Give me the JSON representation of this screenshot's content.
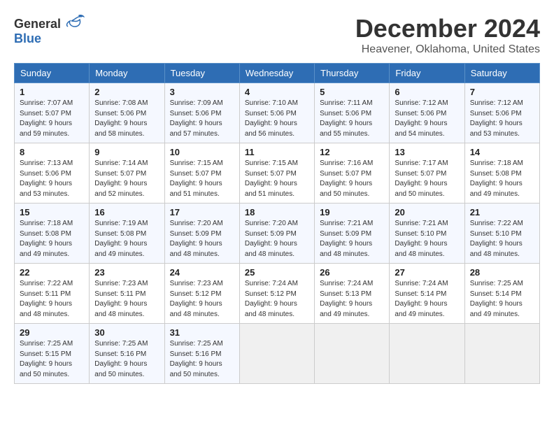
{
  "header": {
    "logo_general": "General",
    "logo_blue": "Blue",
    "month": "December 2024",
    "location": "Heavener, Oklahoma, United States"
  },
  "days_of_week": [
    "Sunday",
    "Monday",
    "Tuesday",
    "Wednesday",
    "Thursday",
    "Friday",
    "Saturday"
  ],
  "weeks": [
    [
      {
        "day": "1",
        "sunrise": "Sunrise: 7:07 AM",
        "sunset": "Sunset: 5:07 PM",
        "daylight": "Daylight: 9 hours and 59 minutes."
      },
      {
        "day": "2",
        "sunrise": "Sunrise: 7:08 AM",
        "sunset": "Sunset: 5:06 PM",
        "daylight": "Daylight: 9 hours and 58 minutes."
      },
      {
        "day": "3",
        "sunrise": "Sunrise: 7:09 AM",
        "sunset": "Sunset: 5:06 PM",
        "daylight": "Daylight: 9 hours and 57 minutes."
      },
      {
        "day": "4",
        "sunrise": "Sunrise: 7:10 AM",
        "sunset": "Sunset: 5:06 PM",
        "daylight": "Daylight: 9 hours and 56 minutes."
      },
      {
        "day": "5",
        "sunrise": "Sunrise: 7:11 AM",
        "sunset": "Sunset: 5:06 PM",
        "daylight": "Daylight: 9 hours and 55 minutes."
      },
      {
        "day": "6",
        "sunrise": "Sunrise: 7:12 AM",
        "sunset": "Sunset: 5:06 PM",
        "daylight": "Daylight: 9 hours and 54 minutes."
      },
      {
        "day": "7",
        "sunrise": "Sunrise: 7:12 AM",
        "sunset": "Sunset: 5:06 PM",
        "daylight": "Daylight: 9 hours and 53 minutes."
      }
    ],
    [
      {
        "day": "8",
        "sunrise": "Sunrise: 7:13 AM",
        "sunset": "Sunset: 5:06 PM",
        "daylight": "Daylight: 9 hours and 53 minutes."
      },
      {
        "day": "9",
        "sunrise": "Sunrise: 7:14 AM",
        "sunset": "Sunset: 5:07 PM",
        "daylight": "Daylight: 9 hours and 52 minutes."
      },
      {
        "day": "10",
        "sunrise": "Sunrise: 7:15 AM",
        "sunset": "Sunset: 5:07 PM",
        "daylight": "Daylight: 9 hours and 51 minutes."
      },
      {
        "day": "11",
        "sunrise": "Sunrise: 7:15 AM",
        "sunset": "Sunset: 5:07 PM",
        "daylight": "Daylight: 9 hours and 51 minutes."
      },
      {
        "day": "12",
        "sunrise": "Sunrise: 7:16 AM",
        "sunset": "Sunset: 5:07 PM",
        "daylight": "Daylight: 9 hours and 50 minutes."
      },
      {
        "day": "13",
        "sunrise": "Sunrise: 7:17 AM",
        "sunset": "Sunset: 5:07 PM",
        "daylight": "Daylight: 9 hours and 50 minutes."
      },
      {
        "day": "14",
        "sunrise": "Sunrise: 7:18 AM",
        "sunset": "Sunset: 5:08 PM",
        "daylight": "Daylight: 9 hours and 49 minutes."
      }
    ],
    [
      {
        "day": "15",
        "sunrise": "Sunrise: 7:18 AM",
        "sunset": "Sunset: 5:08 PM",
        "daylight": "Daylight: 9 hours and 49 minutes."
      },
      {
        "day": "16",
        "sunrise": "Sunrise: 7:19 AM",
        "sunset": "Sunset: 5:08 PM",
        "daylight": "Daylight: 9 hours and 49 minutes."
      },
      {
        "day": "17",
        "sunrise": "Sunrise: 7:20 AM",
        "sunset": "Sunset: 5:09 PM",
        "daylight": "Daylight: 9 hours and 48 minutes."
      },
      {
        "day": "18",
        "sunrise": "Sunrise: 7:20 AM",
        "sunset": "Sunset: 5:09 PM",
        "daylight": "Daylight: 9 hours and 48 minutes."
      },
      {
        "day": "19",
        "sunrise": "Sunrise: 7:21 AM",
        "sunset": "Sunset: 5:09 PM",
        "daylight": "Daylight: 9 hours and 48 minutes."
      },
      {
        "day": "20",
        "sunrise": "Sunrise: 7:21 AM",
        "sunset": "Sunset: 5:10 PM",
        "daylight": "Daylight: 9 hours and 48 minutes."
      },
      {
        "day": "21",
        "sunrise": "Sunrise: 7:22 AM",
        "sunset": "Sunset: 5:10 PM",
        "daylight": "Daylight: 9 hours and 48 minutes."
      }
    ],
    [
      {
        "day": "22",
        "sunrise": "Sunrise: 7:22 AM",
        "sunset": "Sunset: 5:11 PM",
        "daylight": "Daylight: 9 hours and 48 minutes."
      },
      {
        "day": "23",
        "sunrise": "Sunrise: 7:23 AM",
        "sunset": "Sunset: 5:11 PM",
        "daylight": "Daylight: 9 hours and 48 minutes."
      },
      {
        "day": "24",
        "sunrise": "Sunrise: 7:23 AM",
        "sunset": "Sunset: 5:12 PM",
        "daylight": "Daylight: 9 hours and 48 minutes."
      },
      {
        "day": "25",
        "sunrise": "Sunrise: 7:24 AM",
        "sunset": "Sunset: 5:12 PM",
        "daylight": "Daylight: 9 hours and 48 minutes."
      },
      {
        "day": "26",
        "sunrise": "Sunrise: 7:24 AM",
        "sunset": "Sunset: 5:13 PM",
        "daylight": "Daylight: 9 hours and 49 minutes."
      },
      {
        "day": "27",
        "sunrise": "Sunrise: 7:24 AM",
        "sunset": "Sunset: 5:14 PM",
        "daylight": "Daylight: 9 hours and 49 minutes."
      },
      {
        "day": "28",
        "sunrise": "Sunrise: 7:25 AM",
        "sunset": "Sunset: 5:14 PM",
        "daylight": "Daylight: 9 hours and 49 minutes."
      }
    ],
    [
      {
        "day": "29",
        "sunrise": "Sunrise: 7:25 AM",
        "sunset": "Sunset: 5:15 PM",
        "daylight": "Daylight: 9 hours and 50 minutes."
      },
      {
        "day": "30",
        "sunrise": "Sunrise: 7:25 AM",
        "sunset": "Sunset: 5:16 PM",
        "daylight": "Daylight: 9 hours and 50 minutes."
      },
      {
        "day": "31",
        "sunrise": "Sunrise: 7:25 AM",
        "sunset": "Sunset: 5:16 PM",
        "daylight": "Daylight: 9 hours and 50 minutes."
      },
      null,
      null,
      null,
      null
    ]
  ]
}
